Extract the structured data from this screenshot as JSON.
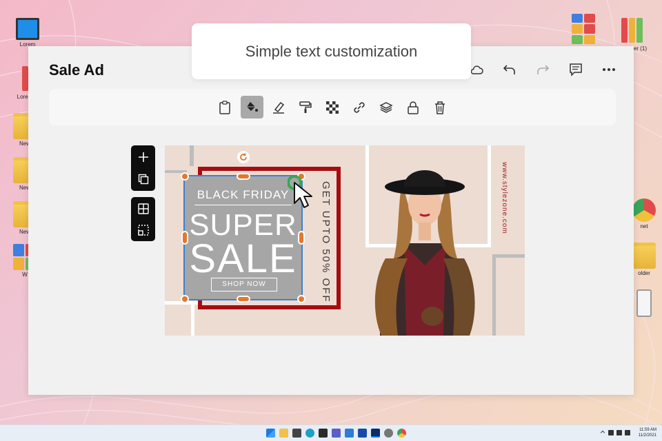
{
  "caption": "Simple text customization",
  "app": {
    "title": "Sale Ad",
    "header_icons": [
      "cloud-icon",
      "undo-icon",
      "redo-icon",
      "comment-icon",
      "more-icon"
    ]
  },
  "toolbar": {
    "tools": [
      "clipboard-icon",
      "fill-bucket-icon",
      "highlighter-icon",
      "paint-roller-icon",
      "transparency-icon",
      "link-icon",
      "layers-icon",
      "lock-icon",
      "trash-icon"
    ],
    "active_tool": "fill-bucket-icon"
  },
  "ad": {
    "black_friday": "BLACK FRIDAY",
    "super": "SUPER",
    "sale": "SALE",
    "shop_now": "SHOP NOW",
    "discount": "GET UPTO 50% OFF",
    "url": "www.stylezone.com",
    "colors": {
      "background": "#eddcd2",
      "frame": "#a80c11",
      "text_box": "#a6a6a6",
      "handle": "#e2782e",
      "selection": "#3c7fd4"
    }
  },
  "desktop": {
    "left_icons": [
      "Lorem",
      "Lorem",
      "New",
      "New",
      "New",
      "W"
    ],
    "right_icons": [
      "",
      "er (1)",
      "net",
      "older",
      ""
    ]
  },
  "taskbar": {
    "time": "11:59 AM",
    "date": "11/2/2021"
  }
}
